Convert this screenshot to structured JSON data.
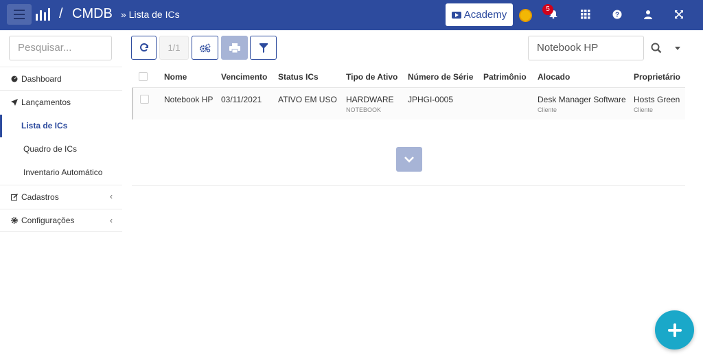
{
  "header": {
    "brand_sep": "/",
    "brand": "CMDB",
    "crumb": "» Lista de ICs",
    "academy_label": "Academy",
    "notifications_count": "5",
    "brand_color": "#2d4b9e"
  },
  "sidebar": {
    "search_placeholder": "Pesquisar...",
    "items": [
      {
        "label": "Dashboard",
        "icon": "dashboard-icon"
      },
      {
        "label": "Lançamentos",
        "icon": "send-icon"
      },
      {
        "label": "Cadastros",
        "icon": "edit-icon"
      },
      {
        "label": "Configurações",
        "icon": "gear-icon"
      }
    ],
    "subitems": [
      {
        "label": "Lista de ICs",
        "active": true
      },
      {
        "label": "Quadro de ICs"
      },
      {
        "label": "Inventario Automático"
      }
    ]
  },
  "toolbar": {
    "page_indicator": "1/1",
    "search_value": "Notebook HP"
  },
  "table": {
    "columns": [
      "Nome",
      "Vencimento",
      "Status ICs",
      "Tipo de Ativo",
      "Número de Série",
      "Patrimônio",
      "Alocado",
      "Proprietário"
    ],
    "rows": [
      {
        "nome": "Notebook HP",
        "vencimento": "03/11/2021",
        "status": "ATIVO EM USO",
        "tipo": "HARDWARE",
        "tipo_sub": "NOTEBOOK",
        "serie": "JPHGI-0005",
        "patrimonio": "",
        "alocado": "Desk Manager Software",
        "alocado_sub": "Cliente",
        "proprietario": "Hosts Green",
        "proprietario_sub": "Cliente"
      }
    ]
  }
}
